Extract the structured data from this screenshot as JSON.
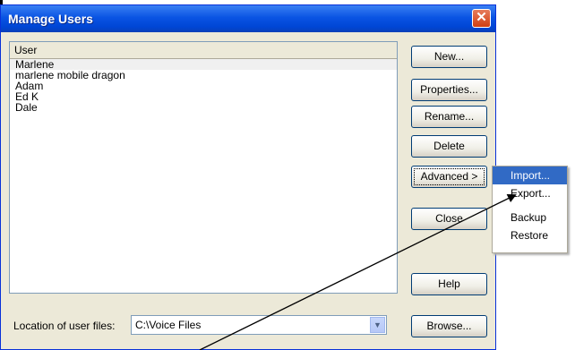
{
  "window": {
    "title": "Manage Users",
    "close_glyph": "✕"
  },
  "user_list": {
    "header": "User",
    "items": [
      "Marlene",
      "marlene mobile dragon",
      "Adam",
      "Ed K",
      "Dale"
    ],
    "selected_index": 0
  },
  "buttons": {
    "new": "New...",
    "properties": "Properties...",
    "rename": "Rename...",
    "delete": "Delete",
    "advanced": "Advanced >",
    "close": "Close",
    "help": "Help",
    "browse": "Browse..."
  },
  "location": {
    "label": "Location of user files:",
    "value": "C:\\Voice Files",
    "dropdown_icon": "chevron-down-icon"
  },
  "advanced_menu": {
    "items": [
      "Import...",
      "Export...",
      "Backup",
      "Restore"
    ],
    "highlighted": "Import..."
  },
  "colors": {
    "titlebar": "#0a54e3",
    "window_bg": "#ece9d8",
    "menu_highlight": "#316ac5",
    "close_button": "#d23f12"
  }
}
